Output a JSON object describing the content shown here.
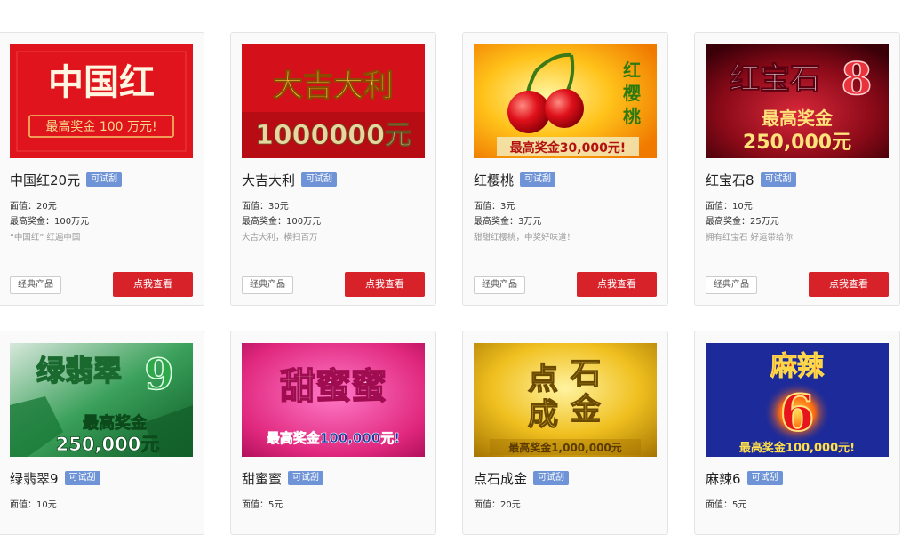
{
  "cards": [
    {
      "title": "中国红20元",
      "badge": "可试刮",
      "face_value": "面值：20元",
      "max_prize": "最高奖金：100万元",
      "desc": "“中国红” 红遍中国",
      "tag": "经典产品",
      "button": "点我查看",
      "art": {
        "title_text": "中国红",
        "prize_text": "最高奖金 100 万元!"
      }
    },
    {
      "title": "大吉大利",
      "badge": "可试刮",
      "face_value": "面值：30元",
      "max_prize": "最高奖金：100万元",
      "desc": "大吉大利，横扫百万",
      "tag": "经典产品",
      "button": "点我查看",
      "art": {
        "title_text": "大吉大利",
        "prize_text": "1000000元"
      }
    },
    {
      "title": "红樱桃",
      "badge": "可试刮",
      "face_value": "面值：3元",
      "max_prize": "最高奖金：3万元",
      "desc": "甜甜红樱桃，中奖好味道！",
      "tag": "经典产品",
      "button": "点我查看",
      "art": {
        "title_text": "红樱桃",
        "prize_text": "最高奖金30,000元!"
      }
    },
    {
      "title": "红宝石8",
      "badge": "可试刮",
      "face_value": "面值：10元",
      "max_prize": "最高奖金：25万元",
      "desc": "拥有红宝石 好运带给你",
      "tag": "经典产品",
      "button": "点我查看",
      "art": {
        "title_text": "红宝石",
        "number": "8",
        "prize_label": "最高奖金",
        "prize_text": "250,000元"
      }
    },
    {
      "title": "绿翡翠9",
      "badge": "可试刮",
      "face_value": "面值：10元",
      "art": {
        "title_text": "绿翡翠",
        "number": "9",
        "prize_label": "最高奖金",
        "prize_text": "250,000元"
      }
    },
    {
      "title": "甜蜜蜜",
      "badge": "可试刮",
      "face_value": "面值：5元",
      "art": {
        "title_text": "甜蜜蜜",
        "prize_text": "最高奖金100,000元!"
      }
    },
    {
      "title": "点石成金",
      "badge": "可试刮",
      "face_value": "面值：20元",
      "art": {
        "title_text": "点石成金",
        "prize_text": "最高奖金1,000,000元"
      }
    },
    {
      "title": "麻辣6",
      "badge": "可试刮",
      "face_value": "面值：5元",
      "art": {
        "title_text": "麻辣",
        "number": "6",
        "prize_text": "最高奖金100,000元!"
      }
    }
  ],
  "colors": {
    "button": "#d7222a",
    "badge": "#6e93d6"
  }
}
